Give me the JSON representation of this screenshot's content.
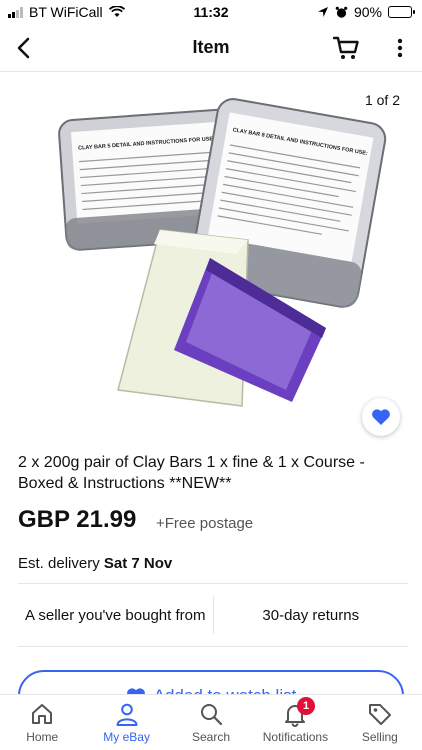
{
  "status_bar": {
    "carrier": "BT WiFiCall",
    "time": "11:32",
    "battery": "90%",
    "battery_level": 0.9
  },
  "nav": {
    "title": "Item",
    "icons": [
      "back-icon",
      "cart-icon",
      "more-icon"
    ]
  },
  "gallery": {
    "counter": "1 of 2",
    "box_label_left": "CLAY BAR 5 DETAIL AND INSTRUCTIONS FOR USE:",
    "box_label_right": "CLAY BAR 8 DETAIL AND INSTRUCTIONS FOR USE:",
    "clay_colors": {
      "fine": "#f1f2e2",
      "course": "#6a3fc0"
    }
  },
  "product": {
    "title": "2 x 200g pair of Clay Bars 1 x fine & 1 x Course - Boxed & Instructions **NEW**",
    "price": "GBP 21.99",
    "postage": "+Free postage",
    "delivery_prefix": "Est. delivery",
    "delivery_date": "Sat 7 Nov"
  },
  "perks": {
    "seller": "A seller you've bought from",
    "returns": "30-day returns"
  },
  "watch_button": {
    "label": "Added to watch list"
  },
  "tabbar": {
    "items": [
      {
        "label": "Home",
        "icon": "home-icon"
      },
      {
        "label": "My eBay",
        "icon": "person-icon"
      },
      {
        "label": "Search",
        "icon": "search-icon"
      },
      {
        "label": "Notifications",
        "icon": "bell-icon",
        "badge": "1"
      },
      {
        "label": "Selling",
        "icon": "tag-icon"
      }
    ]
  },
  "colors": {
    "accent": "#3665f3",
    "badge": "#e0103a"
  }
}
